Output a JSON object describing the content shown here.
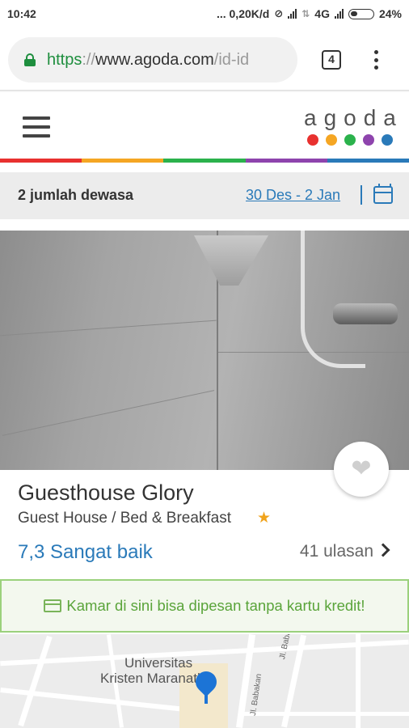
{
  "status_bar": {
    "time": "10:42",
    "network_speed": "... 0,20K/d",
    "network_type": "4G",
    "battery": "24%"
  },
  "browser": {
    "url_scheme": "https",
    "url_separator": "://",
    "url_host": "www.agoda.com",
    "url_path": "/id-id",
    "tab_count": "4"
  },
  "header": {
    "logo_text": "agoda",
    "logo_dot_colors": [
      "#e8312f",
      "#f5a623",
      "#2bb24c",
      "#8e44ad",
      "#2a7ab9"
    ],
    "stripe_colors": [
      "#e8312f",
      "#f5a623",
      "#2bb24c",
      "#8e44ad",
      "#2a7ab9"
    ]
  },
  "search": {
    "guests": "2 jumlah dewasa",
    "dates": "30 Des - 2 Jan"
  },
  "property": {
    "name": "Guesthouse Glory",
    "type": "Guest House / Bed & Breakfast",
    "stars": 1,
    "rating": "7,3 Sangat baik",
    "reviews": "41 ulasan",
    "favorited": false
  },
  "banner": {
    "text": "Kamar di sini bisa dipesan tanpa kartu kredit!"
  },
  "map": {
    "landmark_line1": "Universitas",
    "landmark_line2": "Kristen Maranatha",
    "streets": [
      "Jl. Babakan Jeruk",
      "Jl. Babakan"
    ]
  },
  "colors": {
    "accent_blue": "#2a7ab9",
    "secure_green": "#1e8e3e",
    "banner_green": "#5aa43a",
    "star": "#f0a31c",
    "pin_blue": "#1c74d6"
  }
}
